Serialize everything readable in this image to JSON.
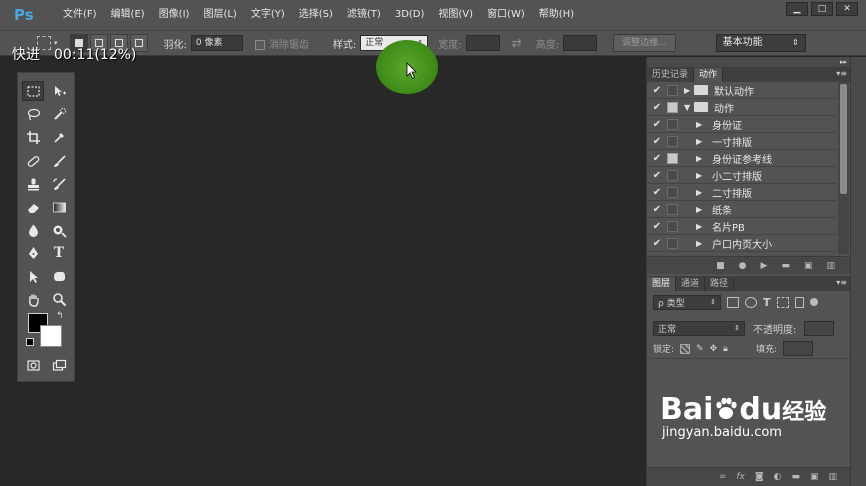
{
  "app": {
    "logo": "Ps"
  },
  "menu": [
    "文件(F)",
    "编辑(E)",
    "图像(I)",
    "图层(L)",
    "文字(Y)",
    "选择(S)",
    "滤镜(T)",
    "3D(D)",
    "视图(V)",
    "窗口(W)",
    "帮助(H)"
  ],
  "window_controls": {
    "minimize": "▁",
    "maximize": "□",
    "close": "✕"
  },
  "options": {
    "feather_label": "羽化:",
    "feather_value": "0 像素",
    "antialias_label": "消除锯齿",
    "style_label": "样式:",
    "style_value": "正常",
    "width_label": "宽度:",
    "height_label": "高度:",
    "refine_edge": "调整边缘...",
    "workspace": "基本功能"
  },
  "overlay": {
    "mode": "快进",
    "time": "00:11(12%)"
  },
  "actions_panel": {
    "tabs": [
      "历史记录",
      "动作"
    ],
    "active_tab": 1,
    "rows": [
      {
        "label": "默认动作",
        "type": "set",
        "expanded": false,
        "dialog": false
      },
      {
        "label": "动作",
        "type": "set",
        "expanded": true,
        "dialog": true
      },
      {
        "label": "身份证",
        "type": "action",
        "dialog": false
      },
      {
        "label": "一寸排版",
        "type": "action",
        "dialog": false
      },
      {
        "label": "身份证参考线",
        "type": "action",
        "dialog": true
      },
      {
        "label": "小二寸排版",
        "type": "action",
        "dialog": false
      },
      {
        "label": "二寸排版",
        "type": "action",
        "dialog": false
      },
      {
        "label": "纸条",
        "type": "action",
        "dialog": false
      },
      {
        "label": "名片PB",
        "type": "action",
        "dialog": false
      },
      {
        "label": "户口内页大小",
        "type": "action",
        "dialog": false
      }
    ]
  },
  "layers_panel": {
    "tabs": [
      "图层",
      "通道",
      "路径"
    ],
    "active_tab": 0,
    "kind_label": "ρ 类型",
    "blend_mode": "正常",
    "opacity_label": "不透明度:",
    "lock_label": "锁定:",
    "fill_label": "填充:"
  },
  "watermark": {
    "logo_bai": "Bai",
    "logo_du": "du",
    "logo_suffix": "经验",
    "url": "jingyan.baidu.com"
  },
  "colors": {
    "accent": "#4aa8e0",
    "click_marker": "#4a9a20",
    "chrome": "#535353",
    "canvas": "#282828"
  }
}
